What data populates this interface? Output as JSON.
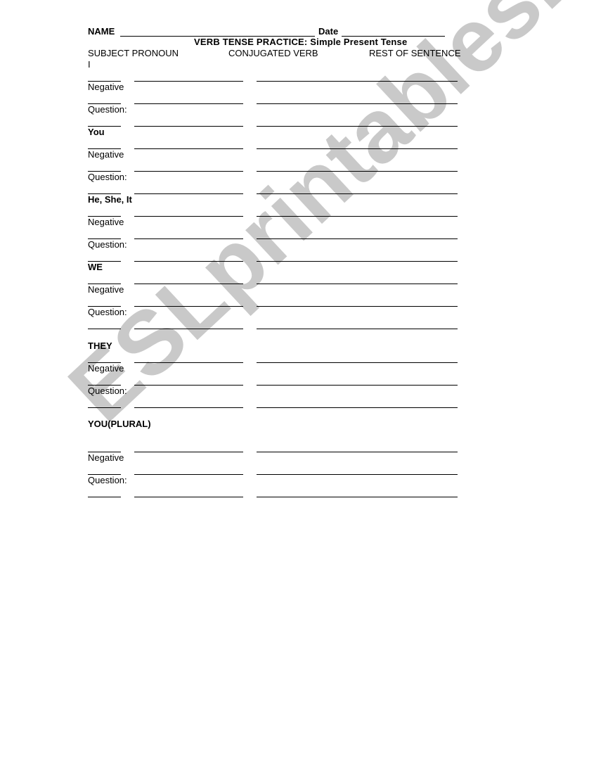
{
  "header": {
    "name_label": "NAME",
    "date_label": "Date",
    "title": "VERB TENSE PRACTICE: Simple Present Tense"
  },
  "columns": {
    "subject": "SUBJECT PRONOUN",
    "verb": "CONJUGATED VERB",
    "rest": "REST OF SENTENCE"
  },
  "rows": [
    {
      "label": "I",
      "bold": false
    },
    {
      "label": "Negative",
      "bold": false
    },
    {
      "label": "Question:",
      "bold": false
    },
    {
      "label": "You",
      "bold": true
    },
    {
      "label": "Negative",
      "bold": false
    },
    {
      "label": "Question:",
      "bold": false
    },
    {
      "label": "He, She, It",
      "bold": true
    },
    {
      "label": "Negative",
      "bold": false
    },
    {
      "label": "Question:",
      "bold": false
    },
    {
      "label": "WE",
      "bold": true
    },
    {
      "label": "Negative",
      "bold": false
    },
    {
      "label": "Question:",
      "bold": false
    },
    {
      "label": "THEY",
      "bold": true
    },
    {
      "label": "Negative",
      "bold": false
    },
    {
      "label": "Question:",
      "bold": false
    },
    {
      "label": "YOU(PLURAL)",
      "bold": true
    },
    {
      "label": "Negative",
      "bold": false
    },
    {
      "label": "Question:",
      "bold": false
    }
  ],
  "watermark": {
    "text": "ESLprintables.com",
    "color": "#c9c9c9"
  }
}
